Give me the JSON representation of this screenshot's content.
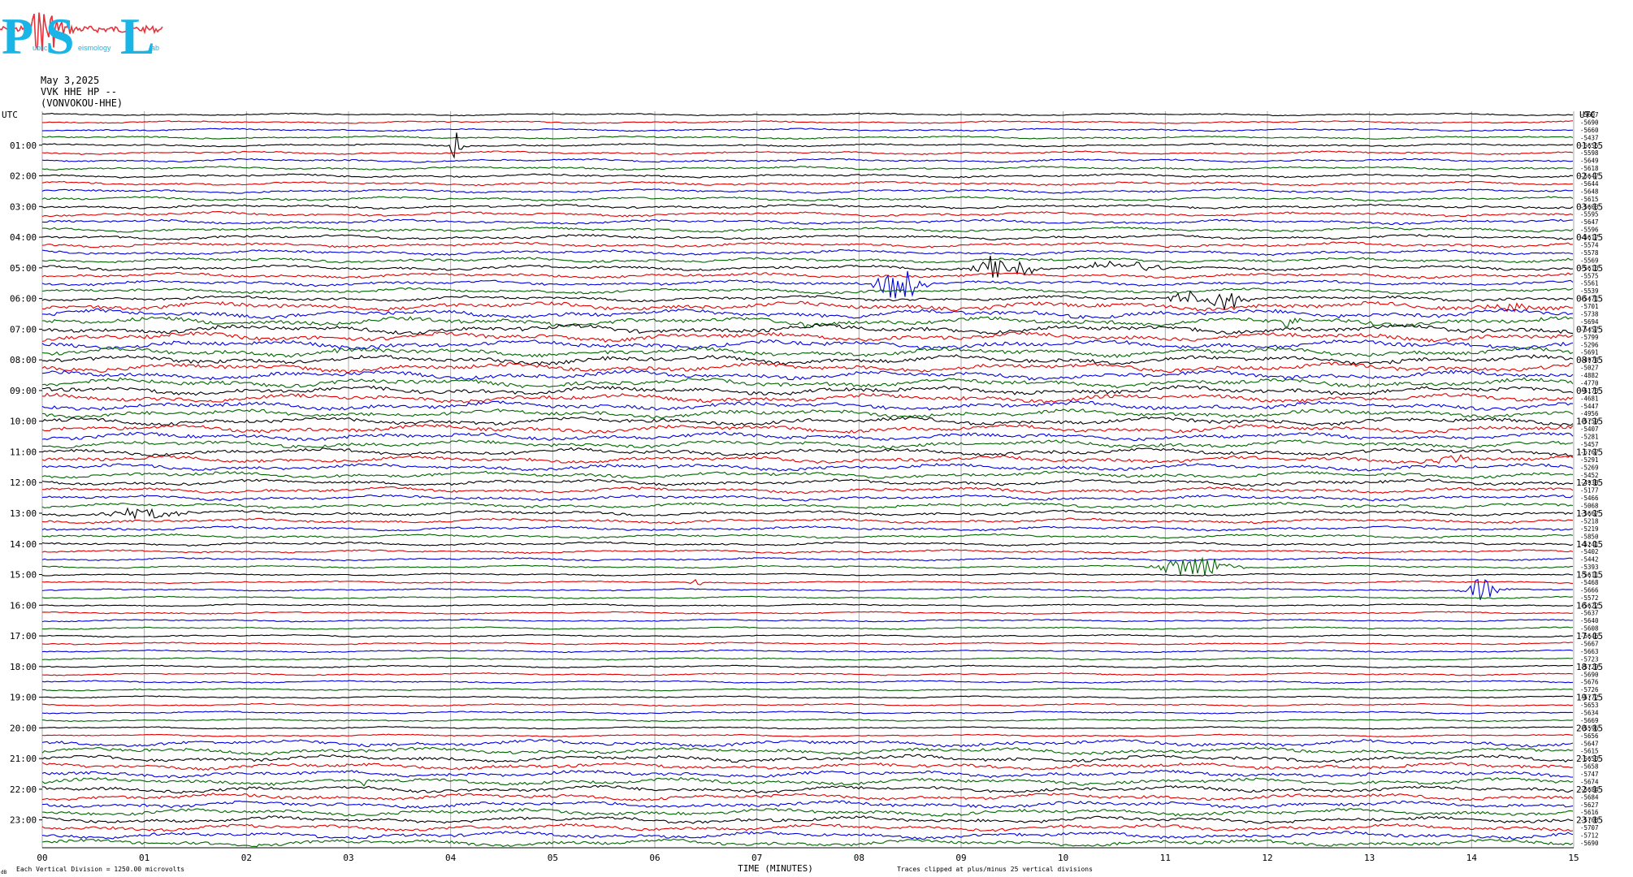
{
  "logo": {
    "letters": [
      "P",
      "S",
      "L"
    ],
    "subtext": [
      "ublic",
      "eismology",
      "ab"
    ],
    "colors": {
      "letters": "#19b5e6",
      "trace": "#e8323c"
    }
  },
  "header": {
    "date": "May 3,2025",
    "station": "VVK HHE HP --",
    "location": "(VONVOKOU-HHE)"
  },
  "chart_data": {
    "type": "line",
    "xlabel": "TIME (MINUTES)",
    "xlim": [
      0,
      15
    ],
    "x_ticks": [
      "00",
      "01",
      "02",
      "03",
      "04",
      "05",
      "06",
      "07",
      "08",
      "09",
      "10",
      "11",
      "12",
      "13",
      "14",
      "15"
    ],
    "left_axis_label": "UTC",
    "right_axis_label": "UTC",
    "left_ticks": [
      "01:00",
      "02:00",
      "03:00",
      "04:00",
      "05:00",
      "06:00",
      "07:00",
      "08:00",
      "09:00",
      "10:00",
      "11:00",
      "12:00",
      "13:00",
      "14:00",
      "15:00",
      "16:00",
      "17:00",
      "18:00",
      "19:00",
      "20:00",
      "21:00",
      "22:00",
      "23:00"
    ],
    "right_ticks": [
      "01:15",
      "02:15",
      "03:15",
      "04:15",
      "05:15",
      "06:15",
      "07:15",
      "08:15",
      "09:15",
      "10:15",
      "11:15",
      "12:15",
      "13:15",
      "14:15",
      "15:15",
      "16:15",
      "17:15",
      "18:15",
      "19:15",
      "20:15",
      "21:15",
      "22:15",
      "23:15"
    ],
    "trace_colors": [
      "#000000",
      "#e00000",
      "#0000e0",
      "#006400"
    ],
    "row_count": 96,
    "trace_offsets": [
      "-5607",
      "-5690",
      "-5660",
      "-5437",
      "-5655",
      "-5598",
      "-5649",
      "-5618",
      "-5647",
      "-5644",
      "-5648",
      "-5615",
      "-5603",
      "-5595",
      "-5647",
      "-5596",
      "-5617",
      "-5574",
      "-5578",
      "-5569",
      "-5613",
      "-5575",
      "-5561",
      "-5539",
      "-5471",
      "-5701",
      "-5738",
      "-5694",
      "-5457",
      "-5799",
      "-5296",
      "-5691",
      "-4974",
      "-5027",
      "-4882",
      "-4770",
      "-5173",
      "-4681",
      "-5447",
      "-4956",
      "-5759",
      "-5407",
      "-5281",
      "-5457",
      "-5767",
      "-5291",
      "-5269",
      "-5452",
      "-4938",
      "-5177",
      "-5466",
      "-5068",
      "-5667",
      "-5218",
      "-5219",
      "-5850",
      "-5241",
      "-5402",
      "-5442",
      "-5393",
      "-5611",
      "-5468",
      "-5666",
      "-5572",
      "-5622",
      "-5637",
      "-5640",
      "-5608",
      "-5646",
      "-5667",
      "-5663",
      "-5723",
      "-5729",
      "-5690",
      "-5676",
      "-5726",
      "-5772",
      "-5653",
      "-5634",
      "-5669",
      "-5596",
      "-5656",
      "-5647",
      "-5615",
      "-5653",
      "-5658",
      "-5747",
      "-5674",
      "-5684",
      "-5684",
      "-5627",
      "-5616",
      "-5708",
      "-5707",
      "-5712",
      "-5690"
    ],
    "footer_left": "Each Vertical Division = 1250.00 microvolts",
    "footer_right": "Traces clipped at plus/minus 25 vertical divisions",
    "corner_label": "dB"
  }
}
